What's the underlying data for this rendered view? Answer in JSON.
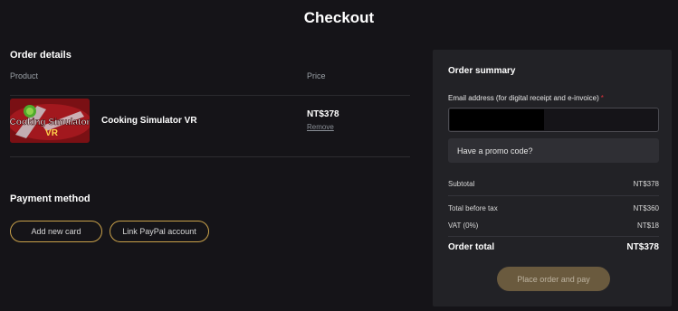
{
  "page": {
    "title": "Checkout"
  },
  "order_details": {
    "title": "Order details",
    "columns": {
      "product": "Product",
      "price": "Price"
    },
    "items": [
      {
        "thumbnail_text_1": "Cooking Simulator",
        "thumbnail_text_2": "VR",
        "name": "Cooking Simulator VR",
        "price": "NT$378",
        "remove_label": "Remove"
      }
    ]
  },
  "payment": {
    "title": "Payment method",
    "add_card_label": "Add new card",
    "paypal_label": "Link PayPal account"
  },
  "summary": {
    "title": "Order summary",
    "email_label": "Email address (for digital receipt and e-invoice)",
    "email_required_mark": "*",
    "email_value": "",
    "promo_label": "Have a promo code?",
    "subtotal_label": "Subtotal",
    "subtotal_value": "NT$378",
    "before_tax_label": "Total before tax",
    "before_tax_value": "NT$360",
    "vat_label": "VAT (0%)",
    "vat_value": "NT$18",
    "total_label": "Order total",
    "total_value": "NT$378",
    "place_order_label": "Place order and pay"
  },
  "colors": {
    "background": "#151418",
    "panel": "#222226",
    "accent_gold": "#c9a14a",
    "required": "#e0303a"
  }
}
